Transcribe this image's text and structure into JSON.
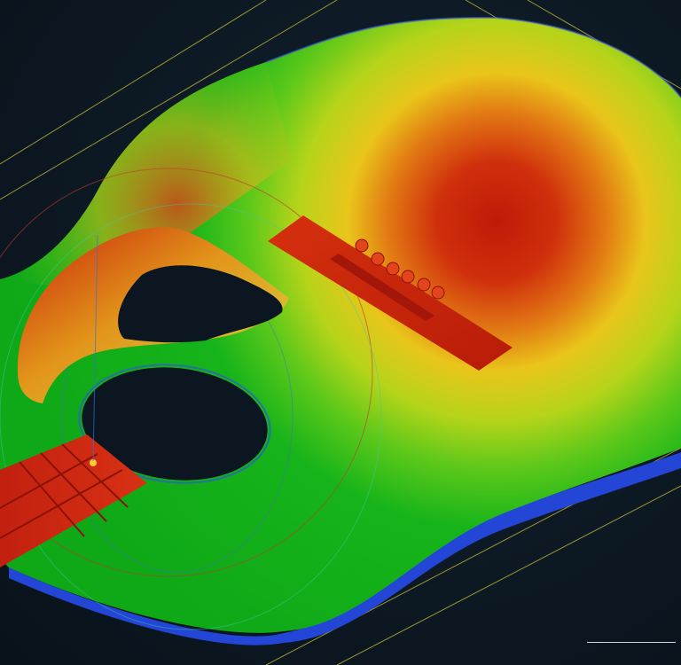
{
  "viewer": {
    "background_color": "#0e1a24",
    "colormap": [
      "#1e4fd8",
      "#11b31a",
      "#9bd61a",
      "#ecd81a",
      "#e8891a",
      "#c21a0a"
    ],
    "grid_line_color": "#c8c23a",
    "axis_colors": {
      "x": "#c23b2a",
      "y": "#3a6fd8",
      "z": "#3fc9a8"
    },
    "pivot_color": "#ffcc33"
  },
  "model": {
    "object": "acoustic-guitar-body",
    "parts": [
      "body-top",
      "soundhole",
      "pickguard",
      "bridge",
      "bridge-pins",
      "fretboard"
    ],
    "bridge_pin_count": 6
  }
}
